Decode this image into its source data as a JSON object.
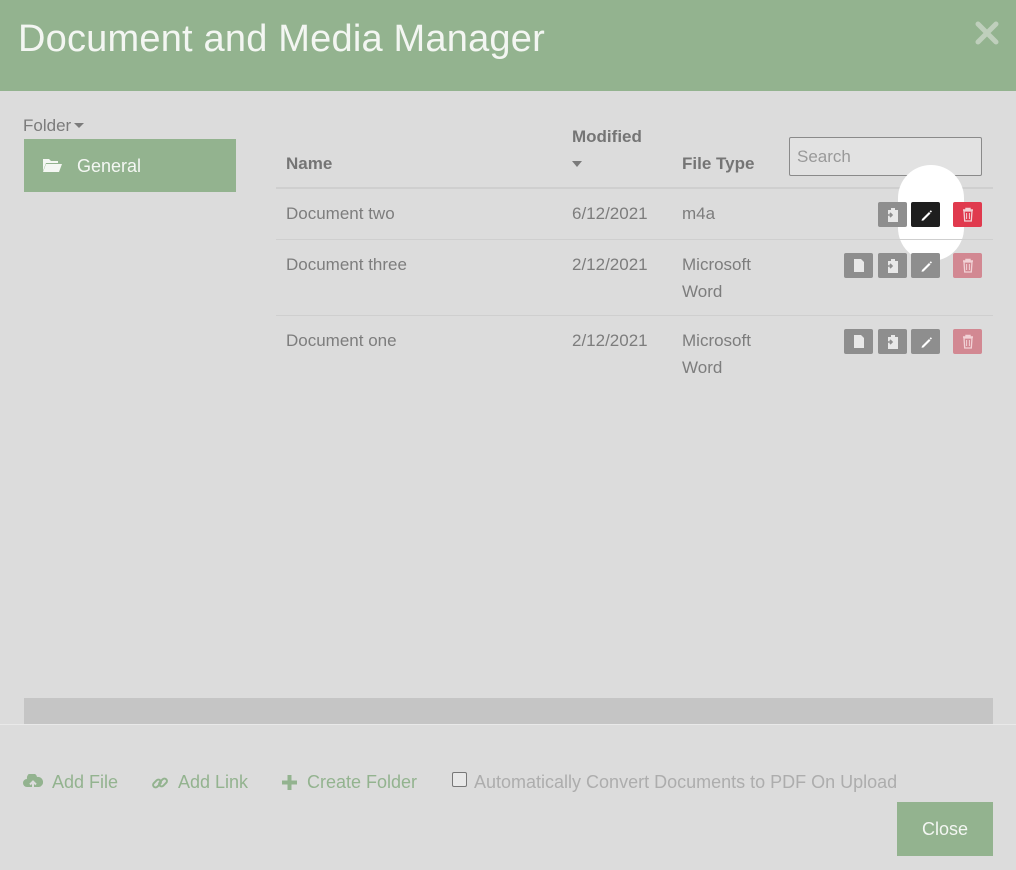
{
  "dialog": {
    "title": "Document and Media Manager"
  },
  "folders": {
    "label": "Folder",
    "items": [
      {
        "label": "General",
        "icon": "folder-open-icon"
      }
    ]
  },
  "table": {
    "headers": {
      "name": "Name",
      "modified": "Modified",
      "file_type": "File Type"
    },
    "search_placeholder": "Search",
    "rows": [
      {
        "name": "Document two",
        "modified": "6/12/2021",
        "file_type": [
          "m4a"
        ]
      },
      {
        "name": "Document three",
        "modified": "2/12/2021",
        "file_type": [
          "Microsoft",
          "Word"
        ]
      },
      {
        "name": "Document one",
        "modified": "2/12/2021",
        "file_type": [
          "Microsoft",
          "Word"
        ]
      }
    ]
  },
  "footer": {
    "add_file": "Add File",
    "add_link": "Add Link",
    "create_folder": "Create Folder",
    "auto_convert_label": "Automatically Convert Documents to PDF On Upload",
    "auto_convert_checked": false,
    "close_label": "Close"
  },
  "colors": {
    "accent": "#93b38f",
    "delete_hover": "#e03a4e",
    "delete": "#d28892",
    "action_gray": "#8e8e8e",
    "action_active": "#1e1e1e"
  }
}
